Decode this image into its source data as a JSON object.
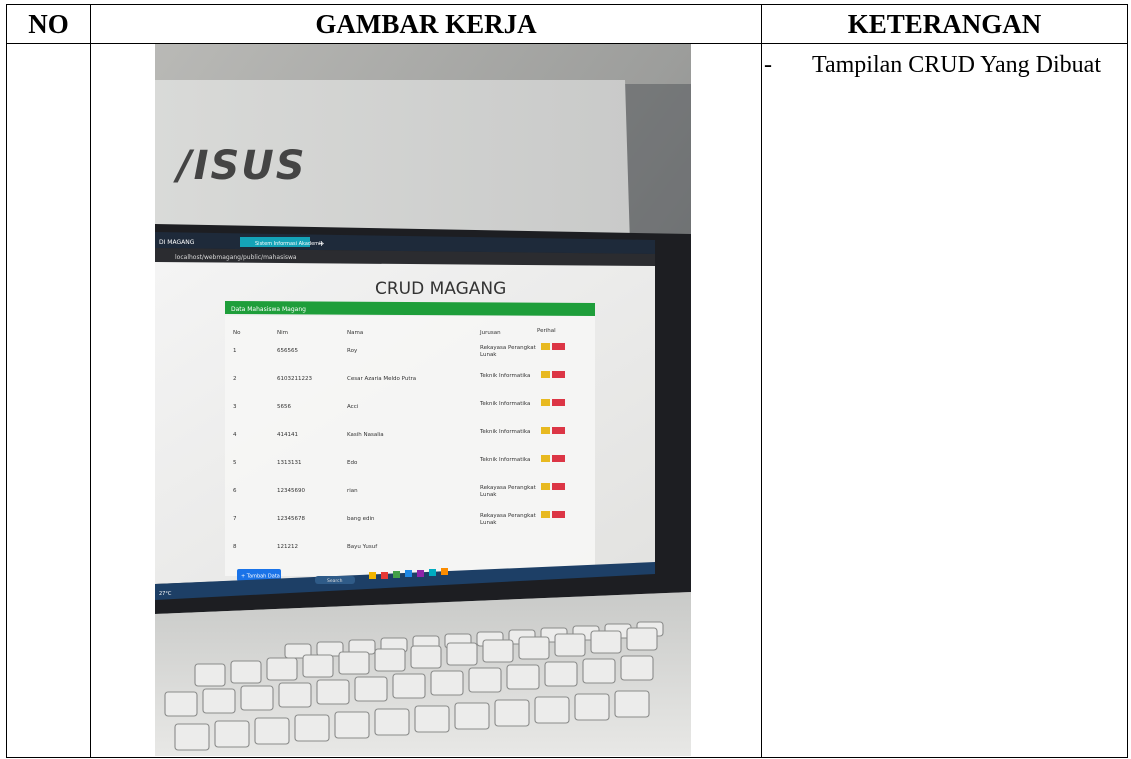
{
  "table": {
    "headers": {
      "no": "NO",
      "gambar": "GAMBAR KERJA",
      "keterangan": "KETERANGAN"
    },
    "rows": [
      {
        "no": "",
        "keterangan": {
          "dash": "-",
          "text": "Tampilan CRUD Yang Dibuat"
        }
      }
    ]
  },
  "photo": {
    "laptop_logo": "/ISUS",
    "tabs": [
      "DI MAGANG",
      "Sistem Informasi Akademik",
      "+"
    ],
    "url": "localhost/webmagang/public/mahasiswa",
    "app_title": "CRUD MAGANG",
    "panel_title": "Data Mahasiswa Magang",
    "columns": [
      "No",
      "Nim",
      "Nama",
      "Jurusan",
      "Perihal"
    ],
    "rows": [
      {
        "no": "1",
        "nim": "656565",
        "nama": "Roy",
        "jurusan": "Rekayasa Perangkat Lunak"
      },
      {
        "no": "2",
        "nim": "6103211223",
        "nama": "Cesar Azaria Meldo Putra",
        "jurusan": "Teknik Informatika"
      },
      {
        "no": "3",
        "nim": "5656",
        "nama": "Acci",
        "jurusan": "Teknik Informatika"
      },
      {
        "no": "4",
        "nim": "414141",
        "nama": "Kasih Nasalia",
        "jurusan": "Teknik Informatika"
      },
      {
        "no": "5",
        "nim": "1313131",
        "nama": "Edo",
        "jurusan": "Teknik Informatika"
      },
      {
        "no": "6",
        "nim": "12345690",
        "nama": "rian",
        "jurusan": "Rekayasa Perangkat Lunak"
      },
      {
        "no": "7",
        "nim": "12345678",
        "nama": "bang edin",
        "jurusan": "Rekayasa Perangkat Lunak"
      },
      {
        "no": "8",
        "nim": "121212",
        "nama": "Bayu Yusuf",
        "jurusan": ""
      }
    ],
    "edit_label": "Edit",
    "delete_label": "Delete",
    "add_button": "+ Tambah Data",
    "taskbar_search": "Search",
    "weather": "27°C"
  },
  "colors": {
    "panel_green": "#1e9e3a",
    "edit_yellow": "#e8b920",
    "delete_red": "#dc3545",
    "taskbar": "#1d3f66",
    "tab_teal": "#14a3b8"
  }
}
